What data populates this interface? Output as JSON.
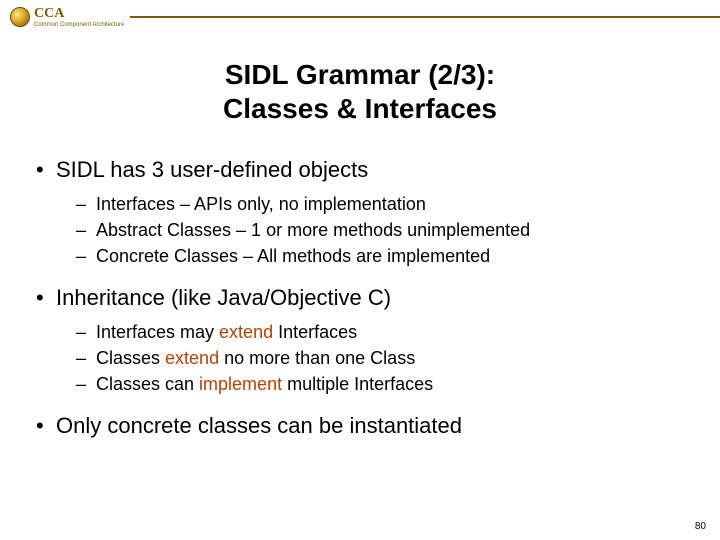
{
  "header": {
    "logo_text": "CCA",
    "logo_subtext": "Common Component Architecture"
  },
  "title_line1": "SIDL Grammar  (2/3):",
  "title_line2": "Classes & Interfaces",
  "bullets": [
    {
      "text": "SIDL has 3 user-defined objects",
      "sub": [
        {
          "plain": "Interfaces – APIs only, no implementation"
        },
        {
          "plain": "Abstract Classes – 1 or more methods unimplemented"
        },
        {
          "plain": "Concrete Classes – All methods are implemented"
        }
      ]
    },
    {
      "text": "Inheritance (like Java/Objective C)",
      "sub": [
        {
          "pre": "Interfaces may ",
          "kw": "extend",
          "post": " Interfaces"
        },
        {
          "pre": "Classes ",
          "kw": "extend",
          "post": " no more than one Class"
        },
        {
          "pre": "Classes can ",
          "kw": "implement",
          "post": " multiple Interfaces"
        }
      ]
    },
    {
      "text": "Only concrete classes can be instantiated",
      "sub": []
    }
  ],
  "page_number": "80"
}
